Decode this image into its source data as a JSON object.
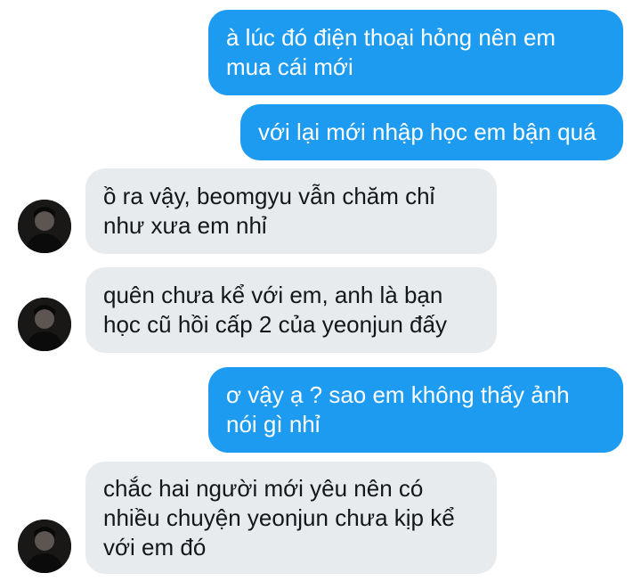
{
  "messages": [
    {
      "side": "out",
      "text": "à lúc đó điện thoại hỏng nên em\nmua cái mới"
    },
    {
      "side": "out",
      "text": "với lại mới nhập học em bận quá"
    },
    {
      "side": "in",
      "text": "ồ ra vậy, beomgyu vẫn chăm chỉ\nnhư xưa em nhỉ"
    },
    {
      "side": "in",
      "text": "quên chưa kể với em, anh là bạn\nhọc cũ hồi cấp 2 của yeonjun đấy"
    },
    {
      "side": "out",
      "text": "ơ vậy ạ ? sao em không thấy ảnh\nnói gì nhỉ"
    },
    {
      "side": "in",
      "text": "chắc hai người mới yêu nên có\nnhiều chuyện yeonjun chưa kịp kể\nvới em đó"
    }
  ],
  "colors": {
    "outgoing_bubble": "#1d9bf0",
    "incoming_bubble": "#e7ebee"
  },
  "icons": {
    "avatar": "user-avatar-photo"
  }
}
